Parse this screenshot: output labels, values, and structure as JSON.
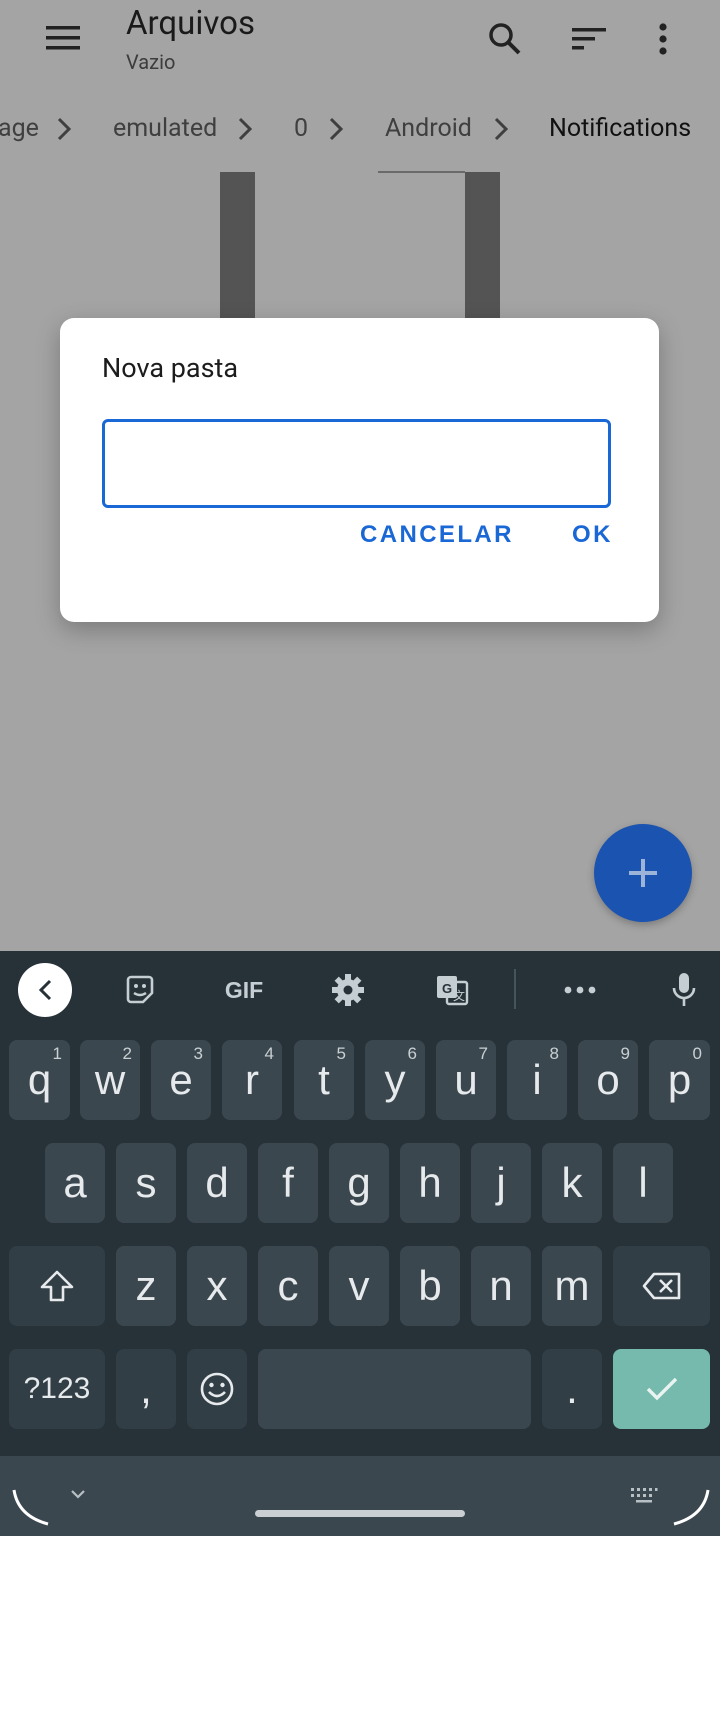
{
  "appbar": {
    "title": "Arquivos",
    "subtitle": "Vazio",
    "menu_icon": "hamburger-menu-icon",
    "search_icon": "search-icon",
    "sort_icon": "sort-icon",
    "more_icon": "more-vert-icon"
  },
  "breadcrumb": {
    "items": [
      "age",
      "emulated",
      "0",
      "Android",
      "Notifications"
    ],
    "active_index": 4
  },
  "dialog": {
    "title": "Nova pasta",
    "input_value": "",
    "cancel_label": "CANCELAR",
    "ok_label": "OK",
    "accent": "#1a68d6"
  },
  "fab": {
    "icon": "plus-icon",
    "color": "#1a53b0"
  },
  "keyboard": {
    "toolbar": [
      "back-icon",
      "sticker-icon",
      "GIF",
      "settings-icon",
      "translate-icon",
      "more-horiz-icon",
      "mic-icon"
    ],
    "gif_label": "GIF",
    "row1": [
      {
        "k": "q",
        "h": "1"
      },
      {
        "k": "w",
        "h": "2"
      },
      {
        "k": "e",
        "h": "3"
      },
      {
        "k": "r",
        "h": "4"
      },
      {
        "k": "t",
        "h": "5"
      },
      {
        "k": "y",
        "h": "6"
      },
      {
        "k": "u",
        "h": "7"
      },
      {
        "k": "i",
        "h": "8"
      },
      {
        "k": "o",
        "h": "9"
      },
      {
        "k": "p",
        "h": "0"
      }
    ],
    "row2": [
      "a",
      "s",
      "d",
      "f",
      "g",
      "h",
      "j",
      "k",
      "l"
    ],
    "row3": [
      "z",
      "x",
      "c",
      "v",
      "b",
      "n",
      "m"
    ],
    "symbols_label": "?123",
    "comma_label": ",",
    "period_label": ".",
    "enter_color": "#76b9ad",
    "background": "#263238"
  }
}
